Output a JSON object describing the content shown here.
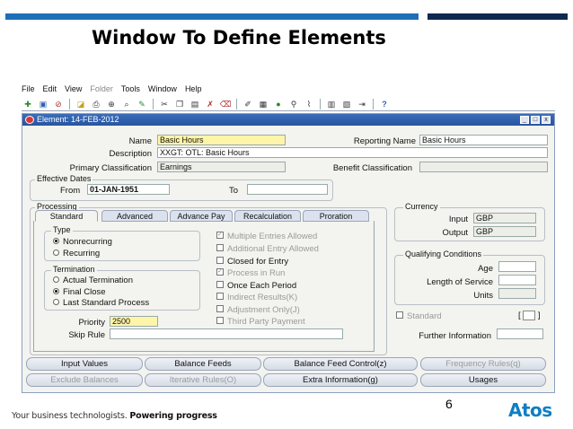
{
  "slide": {
    "title": "Window To Define Elements",
    "page_number": "6",
    "footer_text": "Your business technologists.",
    "footer_bold": "Powering progress",
    "logo_text": "Atos"
  },
  "menubar": [
    "File",
    "Edit",
    "View",
    "Folder",
    "Tools",
    "Window",
    "Help"
  ],
  "toolbar_icons": [
    "new-icon",
    "save-icon",
    "navigate-icon",
    "open-folder-icon",
    "print-icon",
    "zoom-icon",
    "find-icon",
    "cut-icon",
    "copy-icon",
    "paste-icon",
    "clear-icon",
    "delete-icon",
    "edit-icon",
    "attach-icon",
    "globe-icon",
    "link-icon",
    "folder-tools-icon",
    "calendar-icon",
    "record-icon",
    "exit-icon",
    "help-icon"
  ],
  "window": {
    "title": "Element: 14-FEB-2012",
    "buttons": [
      "_",
      "□",
      "x"
    ]
  },
  "form": {
    "name_label": "Name",
    "name_value": "Basic Hours",
    "reporting_name_label": "Reporting Name",
    "reporting_name_value": "Basic Hours",
    "description_label": "Description",
    "description_value": "XXGT: OTL: Basic Hours",
    "primary_classification_label": "Primary Classification",
    "primary_classification_value": "Earnings",
    "benefit_classification_label": "Benefit Classification",
    "benefit_classification_value": "",
    "effective_dates_label": "Effective Dates",
    "from_label": "From",
    "from_value": "01-JAN-1951",
    "to_label": "To",
    "to_value": ""
  },
  "processing": {
    "label": "Processing",
    "tabs": [
      "Standard",
      "Advanced",
      "Advance Pay",
      "Recalculation",
      "Proration"
    ],
    "active_tab": "Standard",
    "type_label": "Type",
    "type_options": [
      "Nonrecurring",
      "Recurring"
    ],
    "type_selected": "Nonrecurring",
    "termination_label": "Termination",
    "termination_options": [
      "Actual Termination",
      "Final Close",
      "Last Standard Process"
    ],
    "termination_selected": "Final Close",
    "checkboxes": [
      {
        "label": "Multiple Entries Allowed",
        "checked": true,
        "disabled": true
      },
      {
        "label": "Additional Entry Allowed",
        "checked": false,
        "disabled": true
      },
      {
        "label": "Closed for Entry",
        "checked": false,
        "disabled": false
      },
      {
        "label": "Process in Run",
        "checked": true,
        "disabled": true
      },
      {
        "label": "Once Each Period",
        "checked": false,
        "disabled": false
      },
      {
        "label": "Indirect Results(K)",
        "checked": false,
        "disabled": true
      },
      {
        "label": "Adjustment Only(J)",
        "checked": false,
        "disabled": true
      },
      {
        "label": "Third Party Payment",
        "checked": false,
        "disabled": true
      }
    ],
    "priority_label": "Priority",
    "priority_value": "2500",
    "skip_rule_label": "Skip Rule",
    "skip_rule_value": ""
  },
  "currency": {
    "label": "Currency",
    "input_label": "Input",
    "input_value": "GBP",
    "output_label": "Output",
    "output_value": "GBP"
  },
  "qualifying": {
    "label": "Qualifying Conditions",
    "age_label": "Age",
    "age_value": "",
    "length_label": "Length of Service",
    "length_value": "",
    "units_label": "Units",
    "units_value": ""
  },
  "standard_check_label": "Standard",
  "standard_bracket_open": "[",
  "standard_bracket_close": "]",
  "further_info_label": "Further Information",
  "further_info_value": "",
  "buttons_row1": [
    {
      "label": "Input Values",
      "disabled": false
    },
    {
      "label": "Balance Feeds",
      "disabled": false
    },
    {
      "label": "Balance Feed Control(z)",
      "disabled": false
    },
    {
      "label": "Frequency Rules(q)",
      "disabled": true
    }
  ],
  "buttons_row2": [
    {
      "label": "Exclude Balances",
      "disabled": true
    },
    {
      "label": "Iterative Rules(O)",
      "disabled": true
    },
    {
      "label": "Extra Information(g)",
      "disabled": false
    },
    {
      "label": "Usages",
      "disabled": false
    }
  ],
  "colors": {
    "accent_blue": "#1f6fb6",
    "dark_navy": "#0f2a4f",
    "window_title": "#2754a0",
    "highlight_yellow": "#fff5a8"
  }
}
